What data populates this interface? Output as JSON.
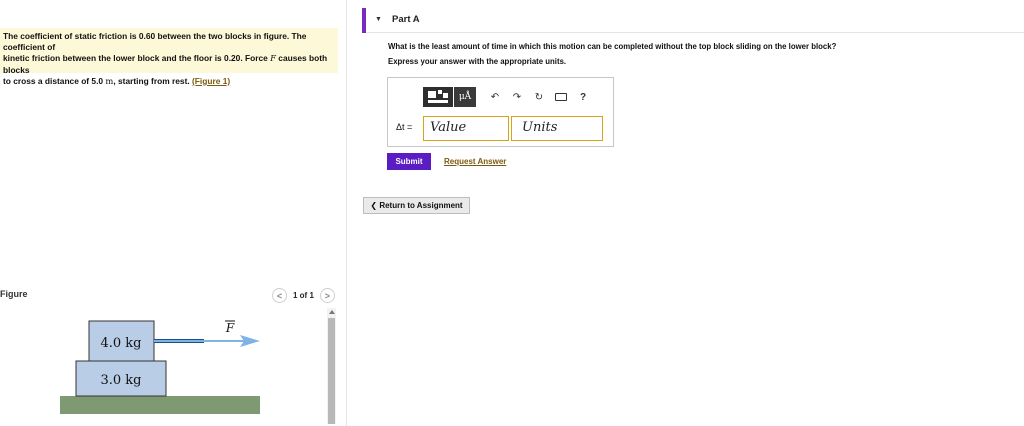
{
  "problem": {
    "line1": "The coefficient of static friction is 0.60 between the two blocks in figure. The coefficient of",
    "line2_pre": "kinetic friction between the lower block and the floor is 0.20. Force ",
    "force_symbol": "F",
    "line2_post": " causes both blocks",
    "line3_pre": "to cross a distance of 5.0 ",
    "unit_m": "m",
    "line3_post": ", starting from rest. ",
    "figure_link": "(Figure 1)"
  },
  "figure": {
    "label": "Figure",
    "prev": "<",
    "counter": "1 of 1",
    "next": ">",
    "top_block": "4.0 kg",
    "bottom_block": "3.0 kg",
    "force_label": "F",
    "colors": {
      "block": "#b9cde6",
      "arrow": "#7fb2e5",
      "rope": "#1b4f8a",
      "floor": "#7f9a72"
    }
  },
  "part": {
    "toggle": "▼",
    "title": "Part A",
    "accent": "#7a2bbf"
  },
  "question": "What is the least amount of time in which this motion can be completed without the top block sliding on the lower block?",
  "instruction": "Express your answer with the appropriate units.",
  "toolbar": {
    "mu_label": "μÅ",
    "undo": "↶",
    "redo": "↷",
    "reset": "↻",
    "help": "?"
  },
  "answer": {
    "variable_label": "Δt =",
    "value_placeholder": "Value",
    "units_placeholder": "Units"
  },
  "actions": {
    "submit": "Submit",
    "request_answer": "Request Answer",
    "return": "❮ Return to Assignment"
  }
}
